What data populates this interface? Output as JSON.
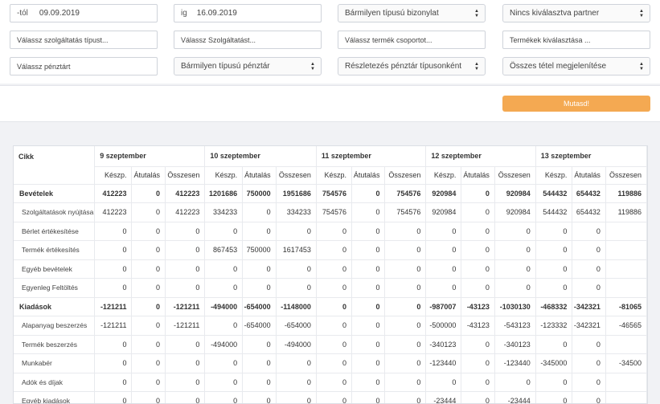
{
  "filters": {
    "date_from_prefix": "-tól",
    "date_from": "09.09.2019",
    "date_to_prefix": "ig",
    "date_to": "16.09.2019",
    "document_type": "Bármilyen típusú bizonylat",
    "partner": "Nincs kiválasztva partner",
    "service_type": "Válassz szolgáltatás típust...",
    "service": "Válassz Szolgáltatást...",
    "product_group": "Válassz termék csoportot...",
    "product": "Termékek kiválasztása ...",
    "cashbox": "Válassz pénztárt",
    "cashbox_type": "Bármilyen típusú pénztár",
    "detail_mode": "Részletezés pénztár típusonként",
    "show_items": "Összes tétel megjelenítése"
  },
  "show_button": "Mutasd!",
  "table": {
    "item_header": "Cikk",
    "days": [
      "9 szeptember",
      "10 szeptember",
      "11 szeptember",
      "12 szeptember",
      "13 szeptember"
    ],
    "sub_headers": [
      "Készp.",
      "Átutalás",
      "Összesen"
    ],
    "rows": [
      {
        "label": "Bevételek",
        "bold": true,
        "values": [
          "412223",
          "0",
          "412223",
          "1201686",
          "750000",
          "1951686",
          "754576",
          "0",
          "754576",
          "920984",
          "0",
          "920984",
          "544432",
          "654432",
          "119886"
        ]
      },
      {
        "label": "Szolgáltatások nyújtása",
        "bold": false,
        "values": [
          "412223",
          "0",
          "412223",
          "334233",
          "0",
          "334233",
          "754576",
          "0",
          "754576",
          "920984",
          "0",
          "920984",
          "544432",
          "654432",
          "119886"
        ]
      },
      {
        "label": "Bérlet értékesítése",
        "bold": false,
        "values": [
          "0",
          "0",
          "0",
          "0",
          "0",
          "0",
          "0",
          "0",
          "0",
          "0",
          "0",
          "0",
          "0",
          "0",
          ""
        ]
      },
      {
        "label": "Termék értékesítés",
        "bold": false,
        "values": [
          "0",
          "0",
          "0",
          "867453",
          "750000",
          "1617453",
          "0",
          "0",
          "0",
          "0",
          "0",
          "0",
          "0",
          "0",
          ""
        ]
      },
      {
        "label": "Egyéb bevételek",
        "bold": false,
        "values": [
          "0",
          "0",
          "0",
          "0",
          "0",
          "0",
          "0",
          "0",
          "0",
          "0",
          "0",
          "0",
          "0",
          "0",
          ""
        ]
      },
      {
        "label": "Egyenleg Feltöltés",
        "bold": false,
        "values": [
          "0",
          "0",
          "0",
          "0",
          "0",
          "0",
          "0",
          "0",
          "0",
          "0",
          "0",
          "0",
          "0",
          "0",
          ""
        ]
      },
      {
        "label": "Kiadások",
        "bold": true,
        "values": [
          "-121211",
          "0",
          "-121211",
          "-494000",
          "-654000",
          "-1148000",
          "0",
          "0",
          "0",
          "-987007",
          "-43123",
          "-1030130",
          "-468332",
          "-342321",
          "-81065"
        ]
      },
      {
        "label": "Alapanyag beszerzés",
        "bold": false,
        "values": [
          "-121211",
          "0",
          "-121211",
          "0",
          "-654000",
          "-654000",
          "0",
          "0",
          "0",
          "-500000",
          "-43123",
          "-543123",
          "-123332",
          "-342321",
          "-46565"
        ]
      },
      {
        "label": "Termék beszerzés",
        "bold": false,
        "values": [
          "0",
          "0",
          "0",
          "-494000",
          "0",
          "-494000",
          "0",
          "0",
          "0",
          "-340123",
          "0",
          "-340123",
          "0",
          "0",
          ""
        ]
      },
      {
        "label": "Munkabér",
        "bold": false,
        "values": [
          "0",
          "0",
          "0",
          "0",
          "0",
          "0",
          "0",
          "0",
          "0",
          "-123440",
          "0",
          "-123440",
          "-345000",
          "0",
          "-34500"
        ]
      },
      {
        "label": "Adók és díjak",
        "bold": false,
        "values": [
          "0",
          "0",
          "0",
          "0",
          "0",
          "0",
          "0",
          "0",
          "0",
          "0",
          "0",
          "0",
          "0",
          "0",
          ""
        ]
      },
      {
        "label": "Egyéb kiadások",
        "bold": false,
        "values": [
          "0",
          "0",
          "0",
          "0",
          "0",
          "0",
          "0",
          "0",
          "0",
          "-23444",
          "0",
          "-23444",
          "0",
          "0",
          ""
        ]
      }
    ]
  }
}
